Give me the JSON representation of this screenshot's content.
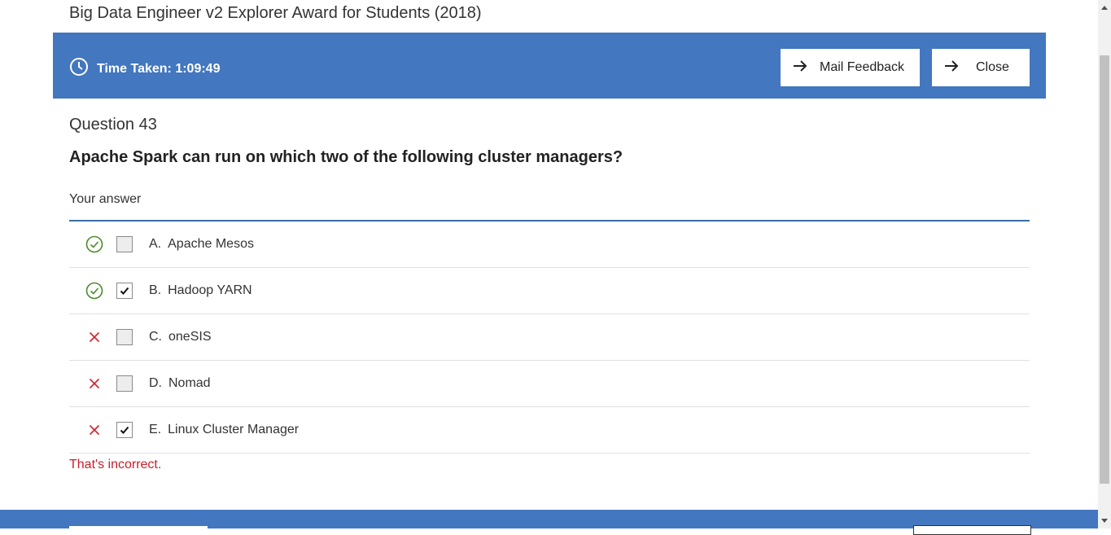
{
  "page": {
    "title": "Big Data Engineer v2 Explorer Award for Students (2018)"
  },
  "banner": {
    "time_taken": "Time Taken: 1:09:49",
    "mail_feedback_label": "Mail Feedback",
    "close_label": "Close",
    "color": "#4377bf"
  },
  "question": {
    "number_label": "Question 43",
    "text": "Apache Spark can run on which two of the following cluster managers?",
    "answer_label": "Your answer"
  },
  "options": [
    {
      "letter": "A.",
      "label": "Apache Mesos",
      "mark": "correct-check-icon",
      "checked": false
    },
    {
      "letter": "B.",
      "label": "Hadoop YARN",
      "mark": "correct-check-icon",
      "checked": true
    },
    {
      "letter": "C.",
      "label": "oneSIS",
      "mark": "incorrect-x-icon",
      "checked": false
    },
    {
      "letter": "D.",
      "label": "Nomad",
      "mark": "incorrect-x-icon",
      "checked": false
    },
    {
      "letter": "E.",
      "label": "Linux Cluster Manager",
      "mark": "incorrect-x-icon",
      "checked": true
    }
  ],
  "result": {
    "message": "That's incorrect.",
    "color": "#c8202a"
  }
}
